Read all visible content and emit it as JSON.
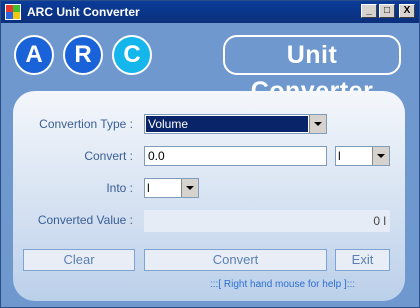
{
  "window": {
    "title": "ARC Unit Converter",
    "controls": [
      "_",
      "□",
      "X"
    ]
  },
  "header": {
    "letters": [
      "A",
      "R",
      "C"
    ],
    "brand": "Unit Converter"
  },
  "form": {
    "conversion_type_label": "Convertion Type :",
    "conversion_type_value": "Volume",
    "convert_label": "Convert :",
    "convert_value": "0.0",
    "from_unit": "l",
    "into_label": "Into :",
    "into_unit": "l",
    "converted_label": "Converted Value :",
    "converted_value": "0 l"
  },
  "buttons": {
    "clear": "Clear",
    "convert": "Convert",
    "exit": "Exit"
  },
  "help_text": ":::[ Right hand mouse for help ]:::"
}
